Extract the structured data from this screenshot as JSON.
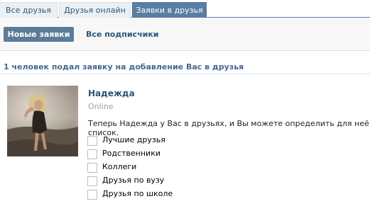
{
  "tabs": [
    {
      "label": "Все друзья"
    },
    {
      "label": "Друзья онлайн"
    },
    {
      "label": "Заявки в друзья",
      "active": true
    }
  ],
  "subtabs": {
    "new_requests": "Новые заявки",
    "all_subscribers": "Все подписчики"
  },
  "summary": "1 человек подал заявку на добавление Вас в друзья",
  "request": {
    "name": "Надежда",
    "status": "Online",
    "message": "Теперь Надежда у Вас в друзьях, и Вы можете определить для неё список.",
    "lists": [
      {
        "label": "Лучшие друзья",
        "checked": false
      },
      {
        "label": "Родственники",
        "checked": false
      },
      {
        "label": "Коллеги",
        "checked": false
      },
      {
        "label": "Друзья по вузу",
        "checked": false
      },
      {
        "label": "Друзья по школе",
        "checked": false
      }
    ]
  },
  "colors": {
    "accent": "#597da3",
    "button": "#5c7b99",
    "link": "#2b587a",
    "summary": "#45688e"
  }
}
